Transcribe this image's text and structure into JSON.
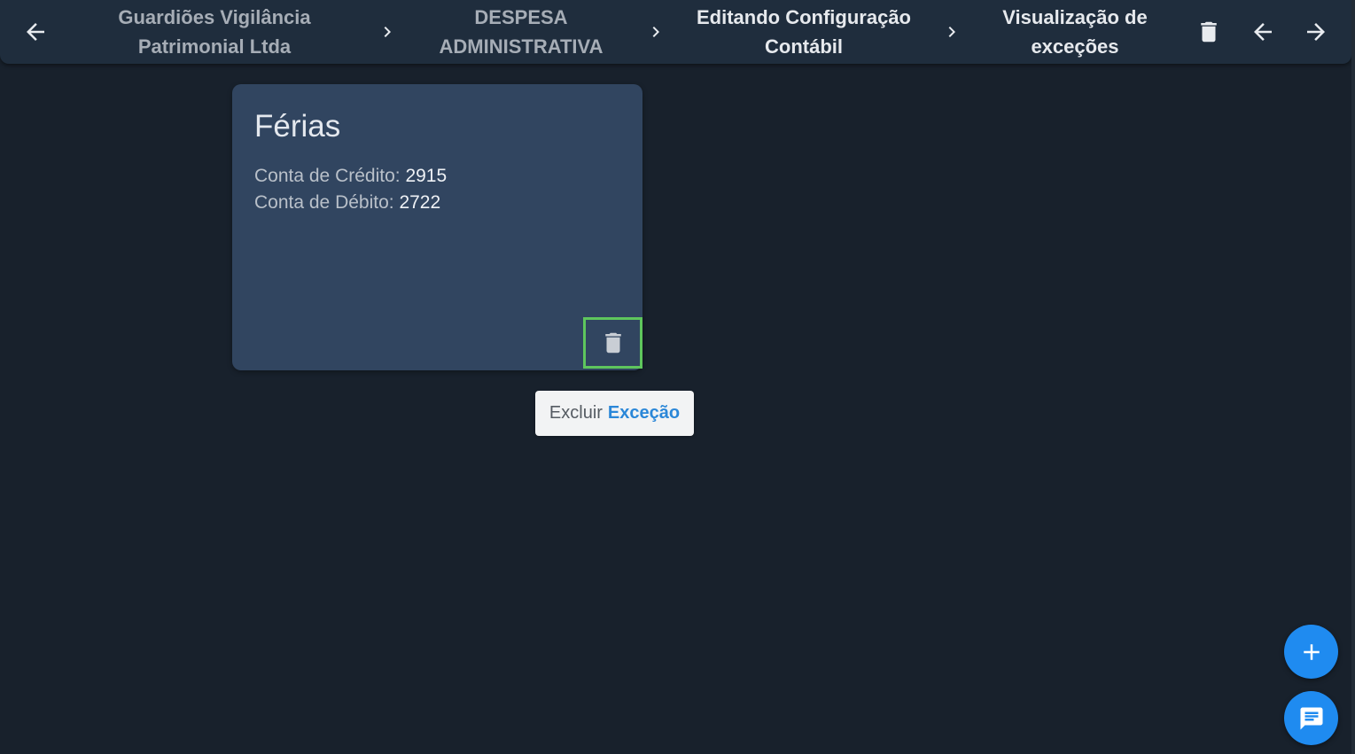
{
  "header": {
    "breadcrumbs": [
      {
        "label": "Guardiões Vigilância\nPatrimonial Ltda"
      },
      {
        "label": "DESPESA\nADMINISTRATIVA"
      },
      {
        "label": "Editando Configuração\nContábil"
      },
      {
        "label": "Visualização de\nexceções"
      }
    ],
    "icons": {
      "back": "arrow-left-icon",
      "separator": "chevron-right-icon",
      "delete": "trash-icon",
      "prev": "arrow-left-icon",
      "next": "arrow-right-icon"
    }
  },
  "card": {
    "title": "Férias",
    "credit_label": "Conta de Crédito:",
    "credit_value": "2915",
    "debit_label": "Conta de Débito:",
    "debit_value": "2722",
    "delete_icon": "trash-icon"
  },
  "tooltip": {
    "prefix": "Excluir",
    "accent": "Exceção"
  },
  "fabs": {
    "add_icon": "plus-icon",
    "chat_icon": "chat-icon"
  },
  "colors": {
    "background": "#18212c",
    "header": "#1f2d3d",
    "card": "#314560",
    "highlight_border": "#5ec65d",
    "accent": "#2b87d8",
    "fab": "#1f8bf0"
  }
}
